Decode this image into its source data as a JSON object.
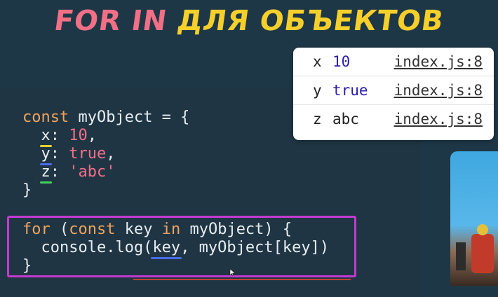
{
  "title": {
    "part1": "FOR IN",
    "part2": "ДЛЯ ОБЪЕКТОВ"
  },
  "code": {
    "line1": {
      "kw": "const",
      "rest": " myObject = {"
    },
    "line2": {
      "key": "x",
      "sep": ": ",
      "val": "10",
      "end": ","
    },
    "line3": {
      "key": "y",
      "sep": ": ",
      "val": "true",
      "end": ","
    },
    "line4": {
      "key": "z",
      "sep": ": ",
      "val": "'abc'"
    },
    "line5": "}",
    "loop1": {
      "kw1": "for",
      "p1": " (",
      "kw2": "const",
      "p2": " key ",
      "kw3": "in",
      "p3": " myObject) {"
    },
    "loop2": {
      "a": "  console.log(",
      "key": "key",
      "b": ", myObject[key])"
    },
    "loop3": "}"
  },
  "console": {
    "rows": [
      {
        "key": "x",
        "value": "10",
        "source": "index.js:8"
      },
      {
        "key": "y",
        "value": "true",
        "source": "index.js:8"
      },
      {
        "key": "z",
        "value": "abc",
        "source": "index.js:8"
      }
    ]
  },
  "colors": {
    "keyword": "#f0a35c",
    "value": "#f26f86",
    "highlight_box": "#c33ad0",
    "title_pink": "#f26f86",
    "title_yellow": "#f6cf2a"
  }
}
